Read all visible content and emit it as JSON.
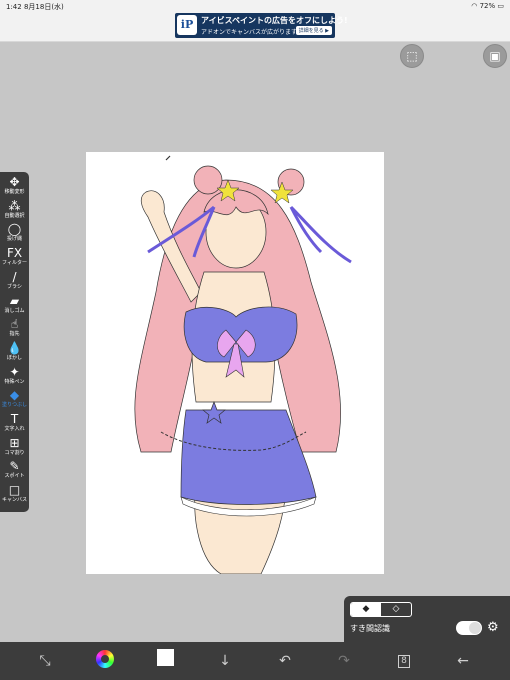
{
  "status": {
    "time": "1:42",
    "date": "8月18日(水)",
    "battery": "72%"
  },
  "ad": {
    "logo": "iP",
    "title": "アイビスペイントの広告をオフにしよう!",
    "subtitle": "アドオンでキャンバスが広がります。",
    "cta": "詳細を見る ▶"
  },
  "top_icons": [
    "selection-icon",
    "image-icon"
  ],
  "toolbar": {
    "items": [
      {
        "icon": "✥",
        "label": "移動変形",
        "name": "move-transform"
      },
      {
        "icon": "⁂",
        "label": "自動選択",
        "name": "magic-wand"
      },
      {
        "icon": "◯",
        "label": "投げ縄",
        "name": "lasso"
      },
      {
        "icon": "FX",
        "label": "フィルター",
        "name": "filter"
      },
      {
        "icon": "/",
        "label": "ブラシ",
        "name": "brush"
      },
      {
        "icon": "▰",
        "label": "消しゴム",
        "name": "eraser"
      },
      {
        "icon": "☝",
        "label": "指先",
        "name": "smudge"
      },
      {
        "icon": "💧",
        "label": "ぼかし",
        "name": "blur"
      },
      {
        "icon": "✦",
        "label": "特殊ペン",
        "name": "special-pen"
      },
      {
        "icon": "◆",
        "label": "塗りつぶし",
        "name": "fill",
        "active": true
      },
      {
        "icon": "T",
        "label": "文字入れ",
        "name": "text"
      },
      {
        "icon": "⊞",
        "label": "コマ割り",
        "name": "frame-divider"
      },
      {
        "icon": "✎",
        "label": "スポイト",
        "name": "eyedropper"
      },
      {
        "icon": "□",
        "label": "キャンバス",
        "name": "canvas"
      }
    ]
  },
  "fill_panel": {
    "mode_fill": "◆",
    "mode_erase": "◇",
    "label": "すき間認識",
    "toggle_on": true
  },
  "bottom": {
    "icons": [
      "transform-icon",
      "color-wheel-icon",
      "color-swatch-icon",
      "download-icon",
      "undo-icon",
      "redo-icon",
      "layers-icon",
      "back-icon"
    ],
    "layers_count": "8",
    "current_color": "#ffffff"
  },
  "colors": {
    "bg": "#c6c6c6",
    "toolbar": "#3c3c3c",
    "accent": "#3a8ee6",
    "hair": "#f2b2b8",
    "skin": "#fbe8d2",
    "outfit": "#7c7ce0",
    "bow": "#e8a6ef"
  }
}
